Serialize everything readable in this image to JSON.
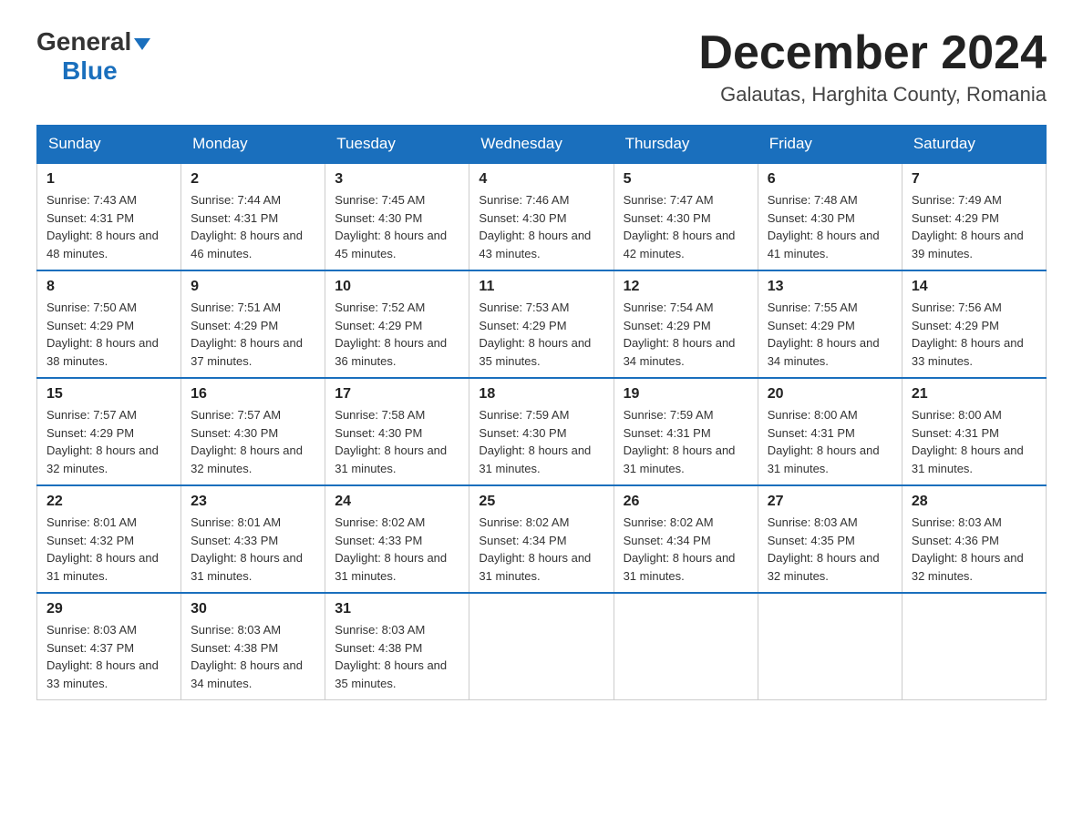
{
  "logo": {
    "general": "General",
    "blue": "Blue"
  },
  "title": "December 2024",
  "subtitle": "Galautas, Harghita County, Romania",
  "weekdays": [
    "Sunday",
    "Monday",
    "Tuesday",
    "Wednesday",
    "Thursday",
    "Friday",
    "Saturday"
  ],
  "weeks": [
    [
      {
        "day": "1",
        "sunrise": "7:43 AM",
        "sunset": "4:31 PM",
        "daylight": "8 hours and 48 minutes."
      },
      {
        "day": "2",
        "sunrise": "7:44 AM",
        "sunset": "4:31 PM",
        "daylight": "8 hours and 46 minutes."
      },
      {
        "day": "3",
        "sunrise": "7:45 AM",
        "sunset": "4:30 PM",
        "daylight": "8 hours and 45 minutes."
      },
      {
        "day": "4",
        "sunrise": "7:46 AM",
        "sunset": "4:30 PM",
        "daylight": "8 hours and 43 minutes."
      },
      {
        "day": "5",
        "sunrise": "7:47 AM",
        "sunset": "4:30 PM",
        "daylight": "8 hours and 42 minutes."
      },
      {
        "day": "6",
        "sunrise": "7:48 AM",
        "sunset": "4:30 PM",
        "daylight": "8 hours and 41 minutes."
      },
      {
        "day": "7",
        "sunrise": "7:49 AM",
        "sunset": "4:29 PM",
        "daylight": "8 hours and 39 minutes."
      }
    ],
    [
      {
        "day": "8",
        "sunrise": "7:50 AM",
        "sunset": "4:29 PM",
        "daylight": "8 hours and 38 minutes."
      },
      {
        "day": "9",
        "sunrise": "7:51 AM",
        "sunset": "4:29 PM",
        "daylight": "8 hours and 37 minutes."
      },
      {
        "day": "10",
        "sunrise": "7:52 AM",
        "sunset": "4:29 PM",
        "daylight": "8 hours and 36 minutes."
      },
      {
        "day": "11",
        "sunrise": "7:53 AM",
        "sunset": "4:29 PM",
        "daylight": "8 hours and 35 minutes."
      },
      {
        "day": "12",
        "sunrise": "7:54 AM",
        "sunset": "4:29 PM",
        "daylight": "8 hours and 34 minutes."
      },
      {
        "day": "13",
        "sunrise": "7:55 AM",
        "sunset": "4:29 PM",
        "daylight": "8 hours and 34 minutes."
      },
      {
        "day": "14",
        "sunrise": "7:56 AM",
        "sunset": "4:29 PM",
        "daylight": "8 hours and 33 minutes."
      }
    ],
    [
      {
        "day": "15",
        "sunrise": "7:57 AM",
        "sunset": "4:29 PM",
        "daylight": "8 hours and 32 minutes."
      },
      {
        "day": "16",
        "sunrise": "7:57 AM",
        "sunset": "4:30 PM",
        "daylight": "8 hours and 32 minutes."
      },
      {
        "day": "17",
        "sunrise": "7:58 AM",
        "sunset": "4:30 PM",
        "daylight": "8 hours and 31 minutes."
      },
      {
        "day": "18",
        "sunrise": "7:59 AM",
        "sunset": "4:30 PM",
        "daylight": "8 hours and 31 minutes."
      },
      {
        "day": "19",
        "sunrise": "7:59 AM",
        "sunset": "4:31 PM",
        "daylight": "8 hours and 31 minutes."
      },
      {
        "day": "20",
        "sunrise": "8:00 AM",
        "sunset": "4:31 PM",
        "daylight": "8 hours and 31 minutes."
      },
      {
        "day": "21",
        "sunrise": "8:00 AM",
        "sunset": "4:31 PM",
        "daylight": "8 hours and 31 minutes."
      }
    ],
    [
      {
        "day": "22",
        "sunrise": "8:01 AM",
        "sunset": "4:32 PM",
        "daylight": "8 hours and 31 minutes."
      },
      {
        "day": "23",
        "sunrise": "8:01 AM",
        "sunset": "4:33 PM",
        "daylight": "8 hours and 31 minutes."
      },
      {
        "day": "24",
        "sunrise": "8:02 AM",
        "sunset": "4:33 PM",
        "daylight": "8 hours and 31 minutes."
      },
      {
        "day": "25",
        "sunrise": "8:02 AM",
        "sunset": "4:34 PM",
        "daylight": "8 hours and 31 minutes."
      },
      {
        "day": "26",
        "sunrise": "8:02 AM",
        "sunset": "4:34 PM",
        "daylight": "8 hours and 31 minutes."
      },
      {
        "day": "27",
        "sunrise": "8:03 AM",
        "sunset": "4:35 PM",
        "daylight": "8 hours and 32 minutes."
      },
      {
        "day": "28",
        "sunrise": "8:03 AM",
        "sunset": "4:36 PM",
        "daylight": "8 hours and 32 minutes."
      }
    ],
    [
      {
        "day": "29",
        "sunrise": "8:03 AM",
        "sunset": "4:37 PM",
        "daylight": "8 hours and 33 minutes."
      },
      {
        "day": "30",
        "sunrise": "8:03 AM",
        "sunset": "4:38 PM",
        "daylight": "8 hours and 34 minutes."
      },
      {
        "day": "31",
        "sunrise": "8:03 AM",
        "sunset": "4:38 PM",
        "daylight": "8 hours and 35 minutes."
      },
      null,
      null,
      null,
      null
    ]
  ]
}
